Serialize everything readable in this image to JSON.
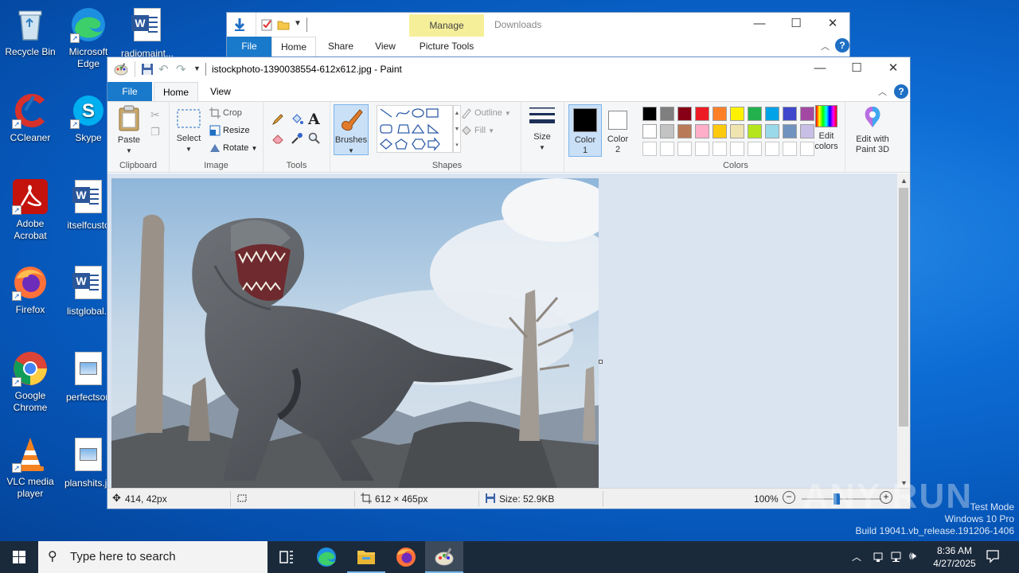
{
  "desktop": {
    "icons": [
      {
        "label": "Recycle Bin"
      },
      {
        "label": "Microsoft Edge"
      },
      {
        "label": "radiomaint..."
      },
      {
        "label": "CCleaner"
      },
      {
        "label": "Skype"
      },
      {
        "label": "Adobe Acrobat"
      },
      {
        "label": "itselfcusto"
      },
      {
        "label": "Firefox"
      },
      {
        "label": "listglobal.r"
      },
      {
        "label": "Google Chrome"
      },
      {
        "label": "perfectson"
      },
      {
        "label": "VLC media player"
      },
      {
        "label": "planshits.jp"
      }
    ]
  },
  "explorer": {
    "manage_label": "Manage",
    "title": "Downloads",
    "tabs": [
      "File",
      "Home",
      "Share",
      "View",
      "Picture Tools"
    ]
  },
  "paint": {
    "title": "istockphoto-1390038554-612x612.jpg - Paint",
    "tabs": [
      "File",
      "Home",
      "View"
    ],
    "clipboard": {
      "paste": "Paste",
      "group": "Clipboard"
    },
    "image": {
      "select": "Select",
      "crop": "Crop",
      "resize": "Resize",
      "rotate": "Rotate",
      "group": "Image"
    },
    "tools": {
      "group": "Tools"
    },
    "brushes": "Brushes",
    "shapes": {
      "outline": "Outline",
      "fill": "Fill",
      "group": "Shapes"
    },
    "size": "Size",
    "color1": {
      "label": "Color",
      "num": "1"
    },
    "color2": {
      "label": "Color",
      "num": "2"
    },
    "colors_group": "Colors",
    "edit_colors": [
      "Edit",
      "colors"
    ],
    "edit_paint3d": [
      "Edit with",
      "Paint 3D"
    ],
    "palette_row1": [
      "#000000",
      "#7f7f7f",
      "#880015",
      "#ed1c24",
      "#ff7f27",
      "#fff200",
      "#22b14c",
      "#00a2e8",
      "#3f48cc",
      "#a349a4"
    ],
    "palette_row2": [
      "#ffffff",
      "#c3c3c3",
      "#b97a57",
      "#ffaec9",
      "#ffc90e",
      "#efe4b0",
      "#b5e61d",
      "#99d9ea",
      "#7092be",
      "#c8bfe7"
    ],
    "status": {
      "cursor_pos": "414, 42px",
      "dimensions": "612 × 465px",
      "size": "Size: 52.9KB",
      "zoom": "100%"
    }
  },
  "taskbar": {
    "search_placeholder": "Type here to search",
    "time": "8:36 AM",
    "date": "4/27/2025"
  },
  "watermark": {
    "brand": "ANY RUN",
    "line1": "Test Mode",
    "line2": "Windows 10 Pro",
    "line3": "Build 19041.vb_release.191206-1406"
  }
}
